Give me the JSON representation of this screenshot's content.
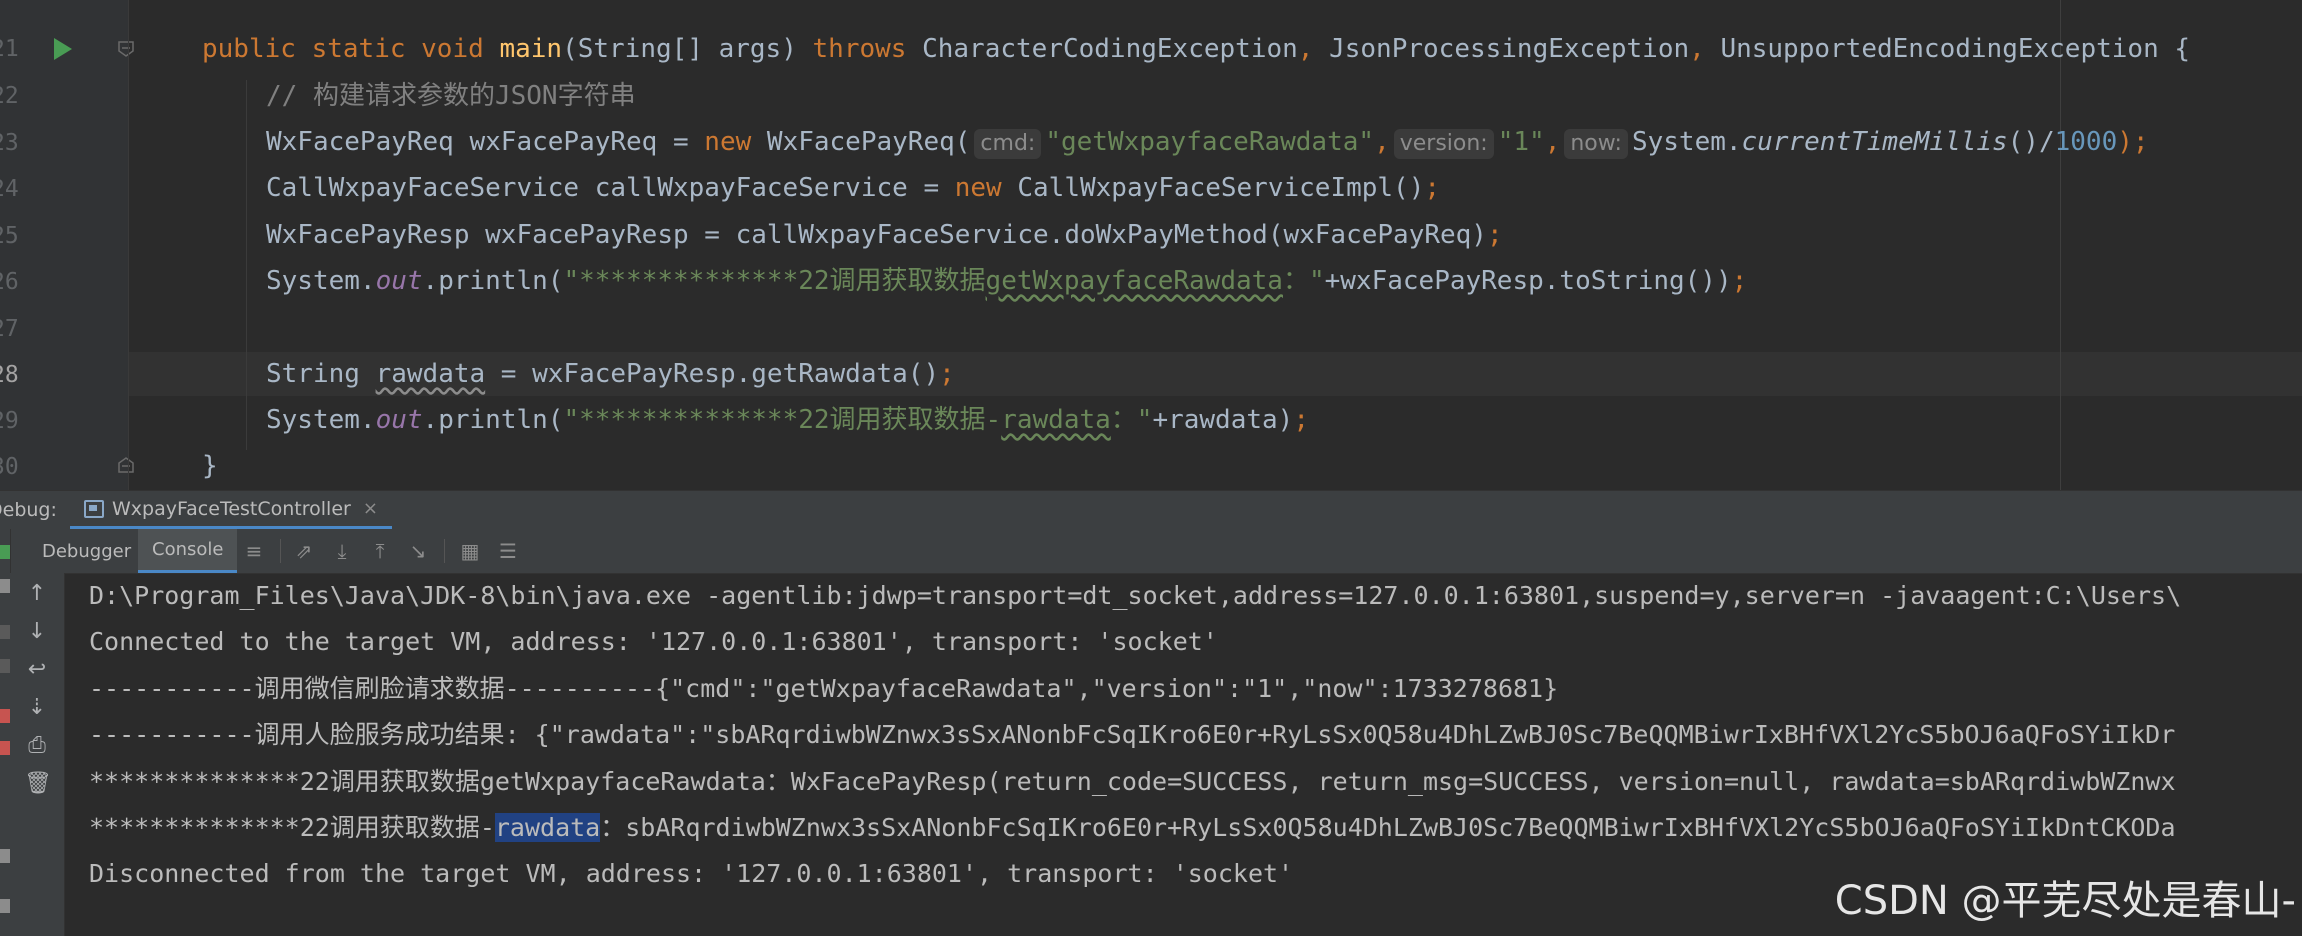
{
  "editor": {
    "line_numbers": [
      "21",
      "22",
      "23",
      "24",
      "25",
      "26",
      "27",
      "28",
      "29",
      "30"
    ],
    "line1": {
      "kw1": "public",
      "kw2": "static",
      "kw3": "void",
      "method": "main",
      "params": "(String[] args) ",
      "throws_kw": "throws",
      "ex1": "CharacterCodingException",
      "comma1": ", ",
      "ex2": "JsonProcessingException",
      "comma2": ", ",
      "ex3": "UnsupportedEncodingException",
      "brace": " {"
    },
    "line2": {
      "comment": "// 构建请求参数的JSON字符串"
    },
    "line3": {
      "decl": "WxFacePayReq wxFacePayReq = ",
      "new_kw": "new",
      "ctor": " WxFacePayReq(",
      "hint_cmd": "cmd:",
      "cmd_val": "\"getWxpayfaceRawdata\"",
      "comma1": ",",
      "hint_version": "version:",
      "version_val": "\"1\"",
      "comma2": ",",
      "hint_now": "now:",
      "now_expr": "System.",
      "now_method": "currentTimeMillis",
      "now_paren": "()/",
      "now_num": "1000",
      "end": ");"
    },
    "line4": {
      "decl": "CallWxpayFaceService callWxpayFaceService = ",
      "new_kw": "new",
      "rest": " CallWxpayFaceServiceImpl()",
      "semi": ";"
    },
    "line5": {
      "decl": "WxFacePayResp wxFacePayResp = callWxpayFaceService.doWxPayMethod(wxFacePayReq)",
      "semi": ";"
    },
    "line6": {
      "pre": "System.",
      "out": "out",
      "mid": ".println(",
      "str_a": "\"**************22调用获取数据",
      "str_b": "getWxpayfaceRawdata",
      "str_c": "：\"",
      "rest": "+wxFacePayResp.toString())",
      "semi": ";"
    },
    "line8": {
      "type": "String ",
      "var": "rawdata",
      "rest": " = wxFacePayResp.getRawdata()",
      "semi": ";"
    },
    "line9": {
      "pre": "System.",
      "out": "out",
      "mid": ".println(",
      "str_a": "\"**************22调用获取数据-",
      "str_b": "rawdata",
      "str_c": "：\"",
      "rest": "+rawdata)",
      "semi": ";"
    },
    "line10": {
      "brace": "}"
    }
  },
  "debug": {
    "label": "Debug:",
    "tab_title": "WxpayFaceTestController",
    "tab_close": "×",
    "subtabs": {
      "debugger": "Debugger",
      "console": "Console"
    }
  },
  "console": {
    "line1": "D:\\Program_Files\\Java\\JDK-8\\bin\\java.exe -agentlib:jdwp=transport=dt_socket,address=127.0.0.1:63801,suspend=y,server=n -javaagent:C:\\Users\\",
    "line2": "Connected to the target VM, address: '127.0.0.1:63801', transport: 'socket'",
    "line3": "-----------调用微信刷脸请求数据----------{\"cmd\":\"getWxpayfaceRawdata\",\"version\":\"1\",\"now\":1733278681}",
    "line4": "-----------调用人脸服务成功结果: {\"rawdata\":\"sbARqrdiwbWZnwx3sSxANonbFcSqIKro6E0r+RyLsSx0Q58u4DhLZwBJ0Sc7BeQQMBiwrIxBHfVXl2YcS5bOJ6aQFoSYiIkDr",
    "line5": "**************22调用获取数据getWxpayfaceRawdata：WxFacePayResp(return_code=SUCCESS, return_msg=SUCCESS, version=null, rawdata=sbARqrdiwbWZnwx",
    "line6_a": "**************22调用获取数据-",
    "line6_sel": "rawdata",
    "line6_b": "：sbARqrdiwbWZnwx3sSxANonbFcSqIKro6E0r+RyLsSx0Q58u4DhLZwBJ0Sc7BeQQMBiwrIxBHfVXl2YcS5bOJ6aQFoSYiIkDntCKODa",
    "line7": "Disconnected from the target VM, address: '127.0.0.1:63801', transport: 'socket'"
  },
  "watermark": "CSDN @平芜尽处是春山-"
}
